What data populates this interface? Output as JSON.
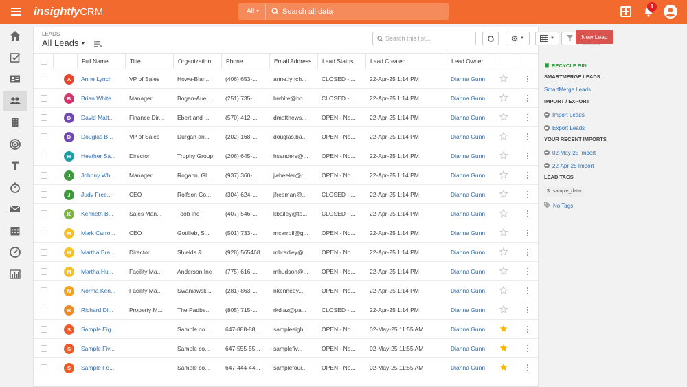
{
  "app": {
    "logo": "insightly",
    "product": "CRM"
  },
  "search": {
    "scope": "All",
    "placeholder": "Search all data"
  },
  "notifications": {
    "count": "1"
  },
  "page": {
    "caption": "LEADS",
    "view_title": "All Leads",
    "list_search_placeholder": "Search this list...",
    "new_lead_label": "New Lead"
  },
  "columns": [
    "Full Name",
    "Title",
    "Organization",
    "Phone",
    "Email Address",
    "Lead Status",
    "Lead Created",
    "Lead Owner"
  ],
  "colors": {
    "accent": "#f26a2e",
    "link": "#2f6fb5",
    "new_lead": "#d9534f",
    "star": "#f5b500"
  },
  "rows": [
    {
      "initial": "A",
      "color": "#e8452c",
      "name": "Anne Lynch",
      "title": "VP of Sales",
      "org": "Howe-Blan...",
      "phone": "(406) 653-...",
      "email": "anne.lynch...",
      "status": "CLOSED - ...",
      "created": "22-Apr-25 1:14 PM",
      "owner": "Dianna Gunn",
      "starred": false
    },
    {
      "initial": "B",
      "color": "#d6336c",
      "name": "Brian White",
      "title": "Manager",
      "org": "Bogan-Aue...",
      "phone": "(251) 735-...",
      "email": "bwhite@bo...",
      "status": "CLOSED - ...",
      "created": "22-Apr-25 1:14 PM",
      "owner": "Dianna Gunn",
      "starred": false
    },
    {
      "initial": "D",
      "color": "#7048b6",
      "name": "David Matt...",
      "title": "Finance Dir...",
      "org": "Ebert and ...",
      "phone": "(570) 412-...",
      "email": "dmatthews...",
      "status": "OPEN - No...",
      "created": "22-Apr-25 1:14 PM",
      "owner": "Dianna Gunn",
      "starred": false
    },
    {
      "initial": "D",
      "color": "#7048b6",
      "name": "Douglas B...",
      "title": "VP of Sales",
      "org": "Durgan an...",
      "phone": "(202) 168-...",
      "email": "douglas.ba...",
      "status": "OPEN - No...",
      "created": "22-Apr-25 1:14 PM",
      "owner": "Dianna Gunn",
      "starred": false
    },
    {
      "initial": "H",
      "color": "#17a2a8",
      "name": "Heather Sa...",
      "title": "Director",
      "org": "Trophy Group",
      "phone": "(206) 645-...",
      "email": "hsanders@...",
      "status": "OPEN - No...",
      "created": "22-Apr-25 1:14 PM",
      "owner": "Dianna Gunn",
      "starred": false
    },
    {
      "initial": "J",
      "color": "#3c9a3c",
      "name": "Johnny Wh...",
      "title": "Manager",
      "org": "Rogahn, Gl...",
      "phone": "(937) 360-...",
      "email": "jwheeler@r...",
      "status": "OPEN - No...",
      "created": "22-Apr-25 1:14 PM",
      "owner": "Dianna Gunn",
      "starred": false
    },
    {
      "initial": "J",
      "color": "#3c9a3c",
      "name": "Judy Free...",
      "title": "CEO",
      "org": "Rolfson Co...",
      "phone": "(304) 624-...",
      "email": "jfreeman@...",
      "status": "CLOSED - ...",
      "created": "22-Apr-25 1:14 PM",
      "owner": "Dianna Gunn",
      "starred": false
    },
    {
      "initial": "K",
      "color": "#7cb342",
      "name": "Kenneth B...",
      "title": "Sales Man...",
      "org": "Toob Inc",
      "phone": "(407) 546-...",
      "email": "kbailey@to...",
      "status": "CLOSED - ...",
      "created": "22-Apr-25 1:14 PM",
      "owner": "Dianna Gunn",
      "starred": false
    },
    {
      "initial": "M",
      "color": "#f6c026",
      "name": "Mark Carro...",
      "title": "CEO",
      "org": "Gottlieb, S...",
      "phone": "(501) 733-...",
      "email": "mcarroll@g...",
      "status": "OPEN - No...",
      "created": "22-Apr-25 1:14 PM",
      "owner": "Dianna Gunn",
      "starred": false
    },
    {
      "initial": "M",
      "color": "#f6c026",
      "name": "Martha Bra...",
      "title": "Director",
      "org": "Shields & ...",
      "phone": "(928) 565468",
      "email": "mbradley@...",
      "status": "OPEN - No...",
      "created": "22-Apr-25 1:14 PM",
      "owner": "Dianna Gunn",
      "starred": false
    },
    {
      "initial": "M",
      "color": "#f6c026",
      "name": "Martha Hu...",
      "title": "Facility Ma...",
      "org": "Anderson Inc",
      "phone": "(775) 616-...",
      "email": "mhudson@...",
      "status": "OPEN - No...",
      "created": "22-Apr-25 1:14 PM",
      "owner": "Dianna Gunn",
      "starred": false
    },
    {
      "initial": "N",
      "color": "#f5a31a",
      "name": "Norma Ken...",
      "title": "Facility Ma...",
      "org": "Swaniawsk...",
      "phone": "(281) 863-...",
      "email": "nkennedy...",
      "status": "OPEN - No...",
      "created": "22-Apr-25 1:14 PM",
      "owner": "Dianna Gunn",
      "starred": false
    },
    {
      "initial": "R",
      "color": "#f08a24",
      "name": "Richard Di...",
      "title": "Property M...",
      "org": "The Padbe...",
      "phone": "(805) 715-...",
      "email": "rkdiaz@pa...",
      "status": "CLOSED - ...",
      "created": "22-Apr-25 1:14 PM",
      "owner": "Dianna Gunn",
      "starred": false
    },
    {
      "initial": "S",
      "color": "#ef5a28",
      "name": "Sample Eig...",
      "title": "",
      "org": "Sample co...",
      "phone": "647-888-88...",
      "email": "sampleeigh...",
      "status": "OPEN - No...",
      "created": "02-May-25 11:55 AM",
      "owner": "Dianna Gunn",
      "starred": true
    },
    {
      "initial": "S",
      "color": "#ef5a28",
      "name": "Sample Fiv...",
      "title": "",
      "org": "Sample co...",
      "phone": "647-555-55...",
      "email": "samplefiv...",
      "status": "OPEN - No...",
      "created": "02-May-25 11:55 AM",
      "owner": "Dianna Gunn",
      "starred": true
    },
    {
      "initial": "S",
      "color": "#ef5a28",
      "name": "Sample Fo...",
      "title": "",
      "org": "Sample co...",
      "phone": "647-444-44...",
      "email": "samplefour...",
      "status": "OPEN - No...",
      "created": "02-May-25 11:55 AM",
      "owner": "Dianna Gunn",
      "starred": true
    }
  ],
  "right_sidebar": {
    "recycle_bin": "RECYCLE BIN",
    "smartmerge_head": "SMARTMERGE LEADS",
    "smartmerge_link": "SmartMerge Leads",
    "import_export_head": "IMPORT / EXPORT",
    "import_link": "Import Leads",
    "export_link": "Export Leads",
    "recent_imports_head": "YOUR RECENT IMPORTS",
    "import_1": "02-May-25 Import",
    "import_2": "22-Apr-25 Import",
    "lead_tags_head": "LEAD TAGS",
    "tag_sample": "sample_data",
    "no_tags": "No Tags"
  }
}
